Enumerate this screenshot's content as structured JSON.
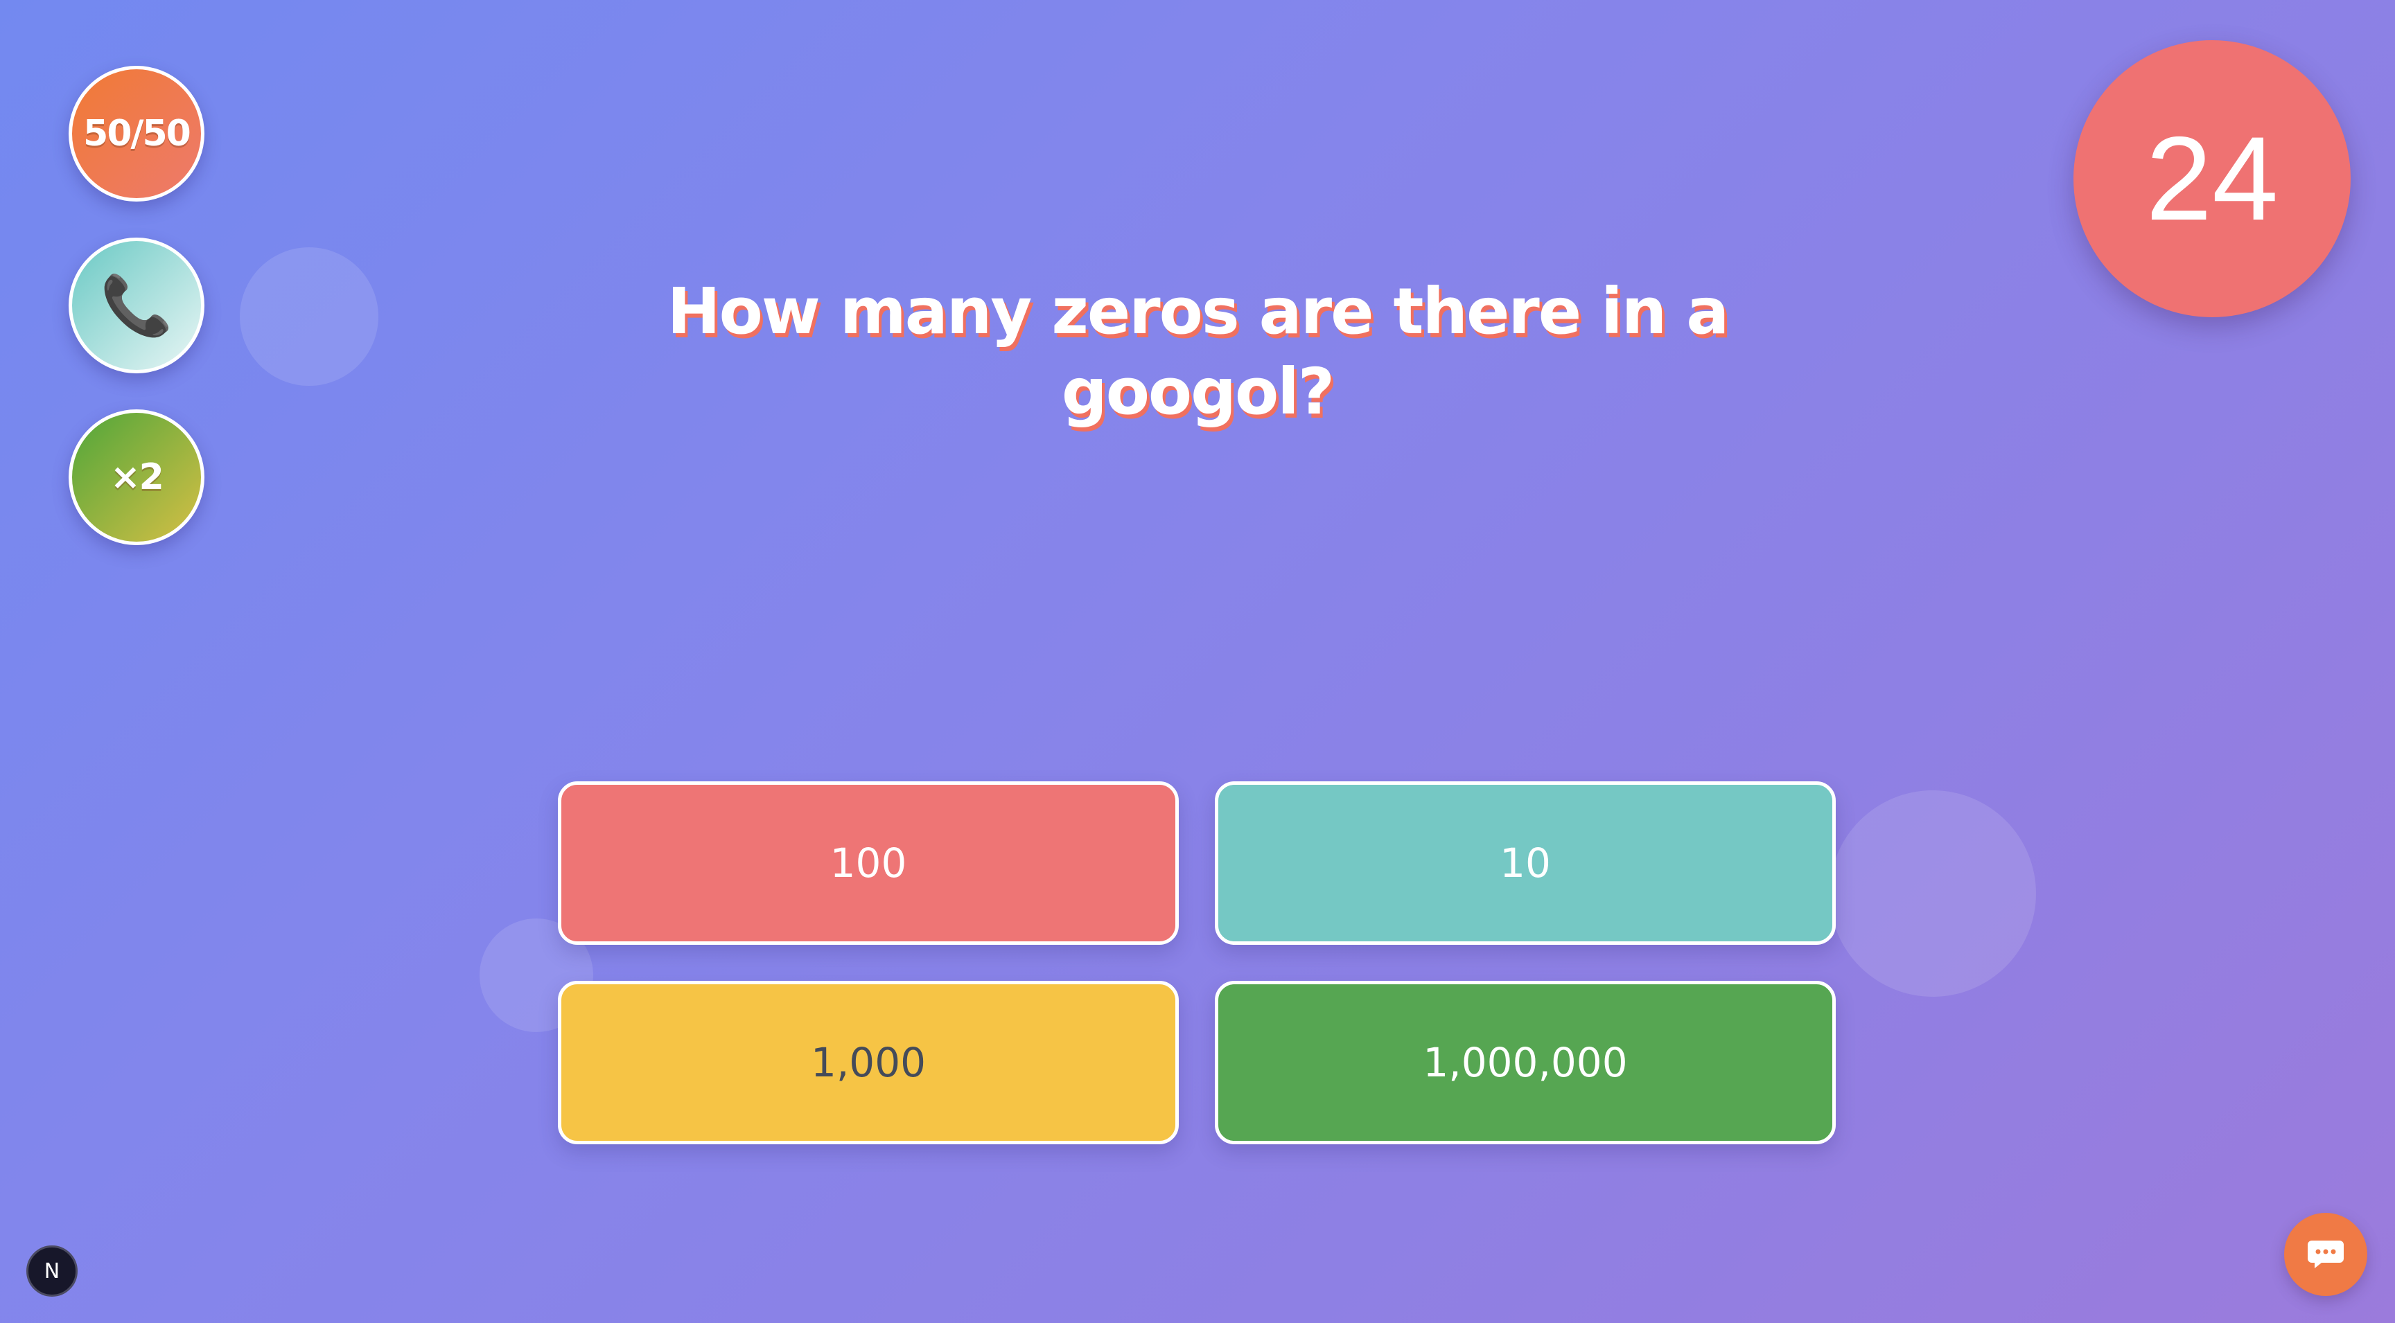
{
  "lifelines": {
    "fifty_fifty": {
      "label": "50/50",
      "icon": "scissors-split-icon"
    },
    "phone_friend": {
      "icon": "phone-icon",
      "glyph": "📞"
    },
    "double_points": {
      "label": "×2",
      "icon": "multiplier-icon"
    }
  },
  "timer": {
    "value": "24"
  },
  "question": {
    "text": "How many zeros are there in a googol?"
  },
  "answers": [
    {
      "label": "100",
      "color": "#ee7575"
    },
    {
      "label": "10",
      "color": "#75c8c4"
    },
    {
      "label": "1,000",
      "color": "#f6c445"
    },
    {
      "label": "1,000,000",
      "color": "#56a652"
    }
  ],
  "dev_badge": {
    "label": "N"
  },
  "chat": {
    "icon": "chat-bubble-icon"
  },
  "colors": {
    "background_start": "#7389f0",
    "background_end": "#9b7bdc",
    "timer": "#ef7272",
    "question_shadow": "#f0705f",
    "chat_button": "#f07a45"
  }
}
